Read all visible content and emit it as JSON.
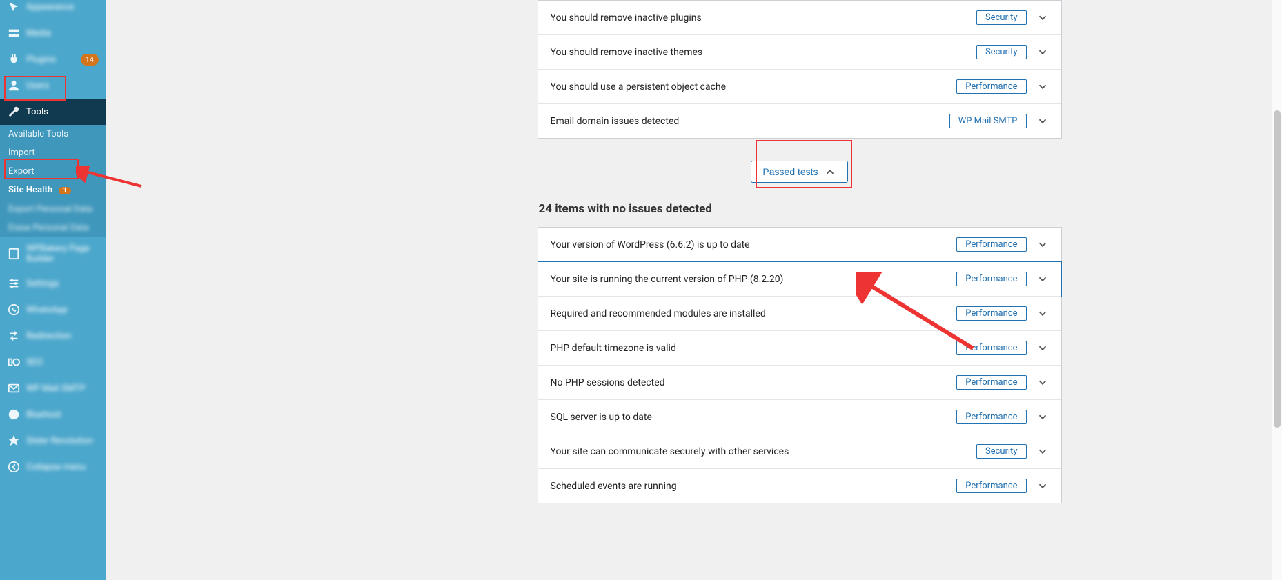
{
  "sidebar": {
    "items": [
      {
        "icon": "appearance",
        "label": "Appearance",
        "badge": null
      },
      {
        "icon": "dash",
        "label": "Media",
        "badge": null
      },
      {
        "icon": "plug",
        "label": "Plugins",
        "badge": "14"
      },
      {
        "icon": "user",
        "label": "Users",
        "badge": null
      }
    ],
    "tools_label": "Tools",
    "tools_sub": [
      {
        "label": "Available Tools",
        "k": "available"
      },
      {
        "label": "Import",
        "k": "import"
      },
      {
        "label": "Export",
        "k": "export"
      },
      {
        "label": "Site Health",
        "k": "sitehealth",
        "badge": "1",
        "active": true
      },
      {
        "label": "Export Personal Data",
        "k": "epd",
        "blur": true
      },
      {
        "label": "Erase Personal Data",
        "k": "erase",
        "blur": true
      }
    ],
    "lower": [
      {
        "icon": "page",
        "label": "WPBakery Page Builder"
      },
      {
        "icon": "slider",
        "label": "Settings"
      },
      {
        "icon": "whats",
        "label": "WhatsApp"
      },
      {
        "icon": "redir",
        "label": "Redirection"
      },
      {
        "icon": "seo",
        "label": "SEO"
      },
      {
        "icon": "mail",
        "label": "WP Mail SMTP"
      },
      {
        "icon": "brand",
        "label": "Bluehost"
      },
      {
        "icon": "revo",
        "label": "Slider Revolution"
      },
      {
        "icon": "collapse",
        "label": "Collapse menu"
      }
    ]
  },
  "issues": [
    {
      "title": "You should remove inactive plugins",
      "badge": "Security"
    },
    {
      "title": "You should remove inactive themes",
      "badge": "Security"
    },
    {
      "title": "You should use a persistent object cache",
      "badge": "Performance"
    },
    {
      "title": "Email domain issues detected",
      "badge": "WP Mail SMTP"
    }
  ],
  "passed_button": "Passed tests",
  "passed_heading": "24 items with no issues detected",
  "passed": [
    {
      "title": "Your version of WordPress (6.6.2) is up to date",
      "badge": "Performance"
    },
    {
      "title": "Your site is running the current version of PHP (8.2.20)",
      "badge": "Performance",
      "highlight": true
    },
    {
      "title": "Required and recommended modules are installed",
      "badge": "Performance"
    },
    {
      "title": "PHP default timezone is valid",
      "badge": "Performance"
    },
    {
      "title": "No PHP sessions detected",
      "badge": "Performance"
    },
    {
      "title": "SQL server is up to date",
      "badge": "Performance"
    },
    {
      "title": "Your site can communicate securely with other services",
      "badge": "Security"
    },
    {
      "title": "Scheduled events are running",
      "badge": "Performance"
    }
  ]
}
